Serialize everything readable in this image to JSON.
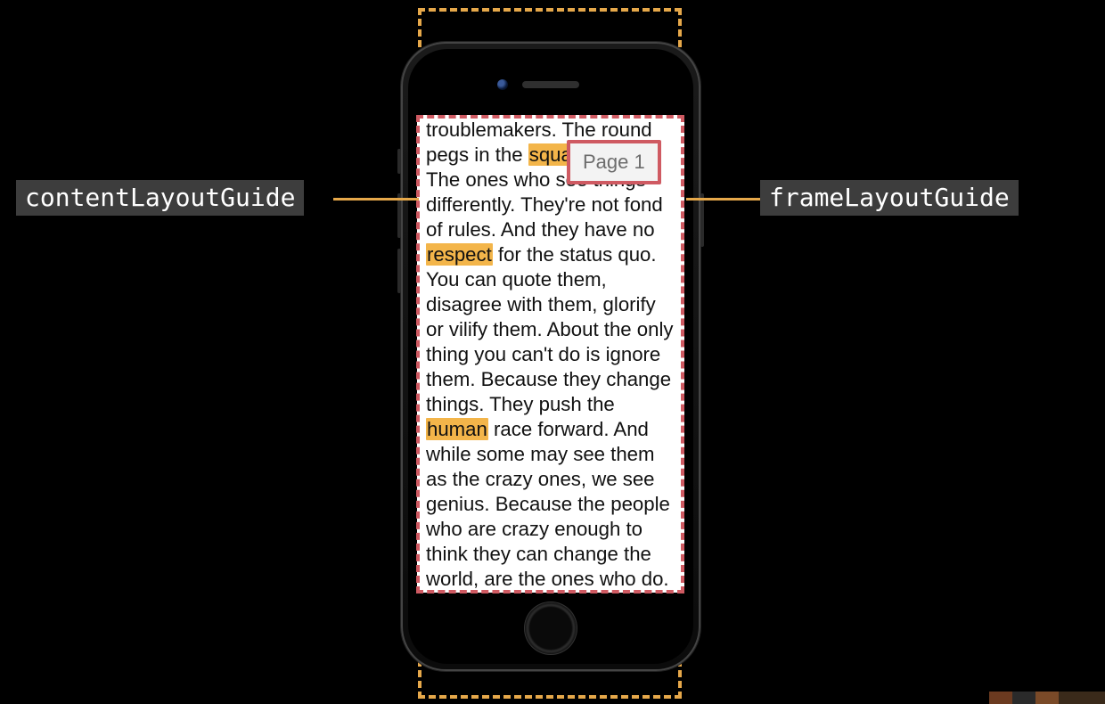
{
  "labels": {
    "content_layout_guide": "contentLayoutGuide",
    "frame_layout_guide": "frameLayoutGuide"
  },
  "page_indicator": "Page 1",
  "body_text": {
    "segments": [
      {
        "t": "troublemakers. The round pegs in the "
      },
      {
        "t": "square",
        "hl": true
      },
      {
        "t": " holes. The ones who see things differently. They're not fond of rules. And they have no "
      },
      {
        "t": "respect",
        "hl": true
      },
      {
        "t": " for the status quo. You can quote them, disagree with them, glorify or vilify them. About the only thing you can't do is ignore them. Because they change things. They push the "
      },
      {
        "t": "human",
        "hl": true
      },
      {
        "t": " race forward. And while some may see them as the crazy ones, we see genius. Because the people who are crazy enough to think they can change the world, are the ones who do."
      }
    ]
  },
  "guides": {
    "content": {
      "color": "#e6a84a"
    },
    "frame": {
      "color": "#cf5a62"
    }
  }
}
